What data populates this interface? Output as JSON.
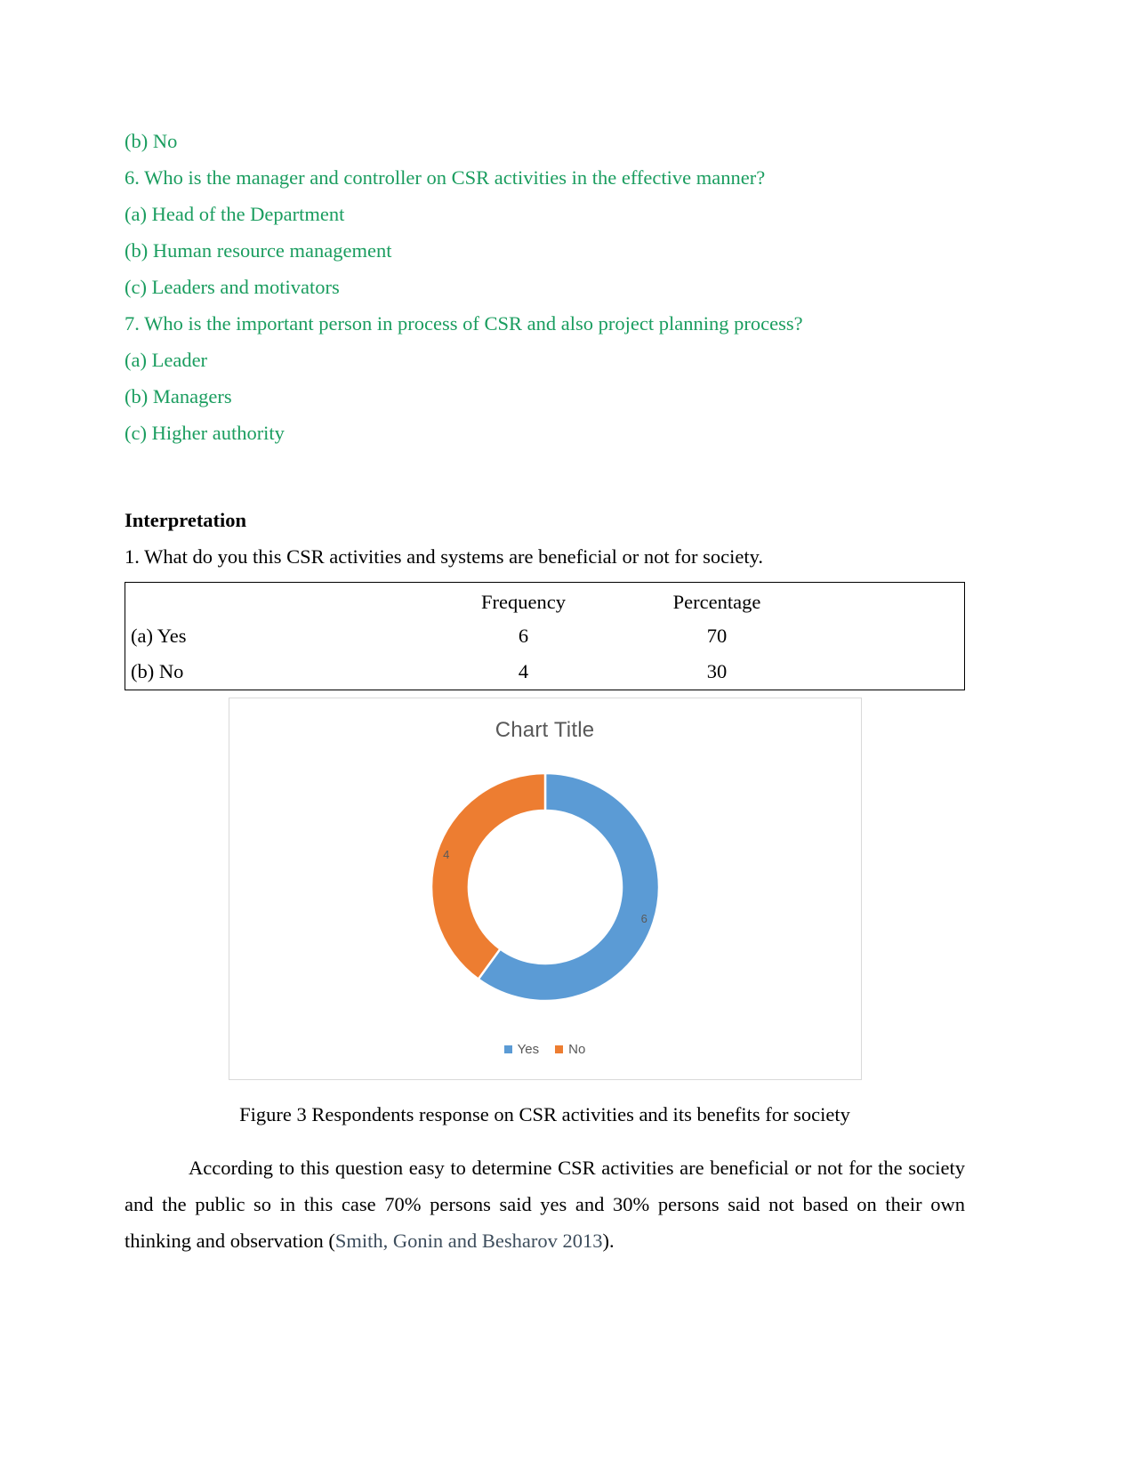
{
  "questionnaire": {
    "lines": [
      "(b) No",
      "6. Who is the manager and controller on CSR activities in the effective manner?",
      "(a) Head of the Department",
      "(b) Human resource management",
      "(c) Leaders and motivators",
      "7. Who is the important person in process of CSR and also project planning process?",
      "(a) Leader",
      "(b) Managers",
      "(c) Higher authority"
    ],
    "text_color": "#1a9d5f"
  },
  "interpretation": {
    "heading": "Interpretation",
    "question": "1. What do you this CSR activities and systems are beneficial or not for society."
  },
  "table": {
    "headers": [
      "",
      "Frequency",
      "Percentage"
    ],
    "rows": [
      {
        "label": "(a) Yes",
        "frequency": "6",
        "percentage": "70"
      },
      {
        "label": "(b) No",
        "frequency": "4",
        "percentage": "30"
      }
    ]
  },
  "chart_data": {
    "type": "pie",
    "title": "Chart Title",
    "subtitle": "",
    "xlabel": "",
    "ylabel": "",
    "variant": "doughnut",
    "categories": [
      "Yes",
      "No"
    ],
    "values": [
      6,
      4
    ],
    "data_labels": [
      "6",
      "4"
    ],
    "percentages": [
      60,
      40
    ],
    "colors": [
      "#5b9bd5",
      "#ed7d31"
    ],
    "legend": [
      "Yes",
      "No"
    ],
    "legend_position": "bottom",
    "grid": false,
    "title_color": "#595959",
    "label_color": "#595959",
    "border_color": "#d9d9d9"
  },
  "caption": "Figure 3 Respondents response on CSR activities and its benefits for society",
  "paragraph": {
    "part1": "According to this question easy to determine CSR activities are beneficial or not for the society and the public so in this case 70% persons said yes and 30% persons said not based on their own thinking and observation (",
    "citation": "Smith, Gonin and Besharov 2013",
    "part2": ")."
  }
}
